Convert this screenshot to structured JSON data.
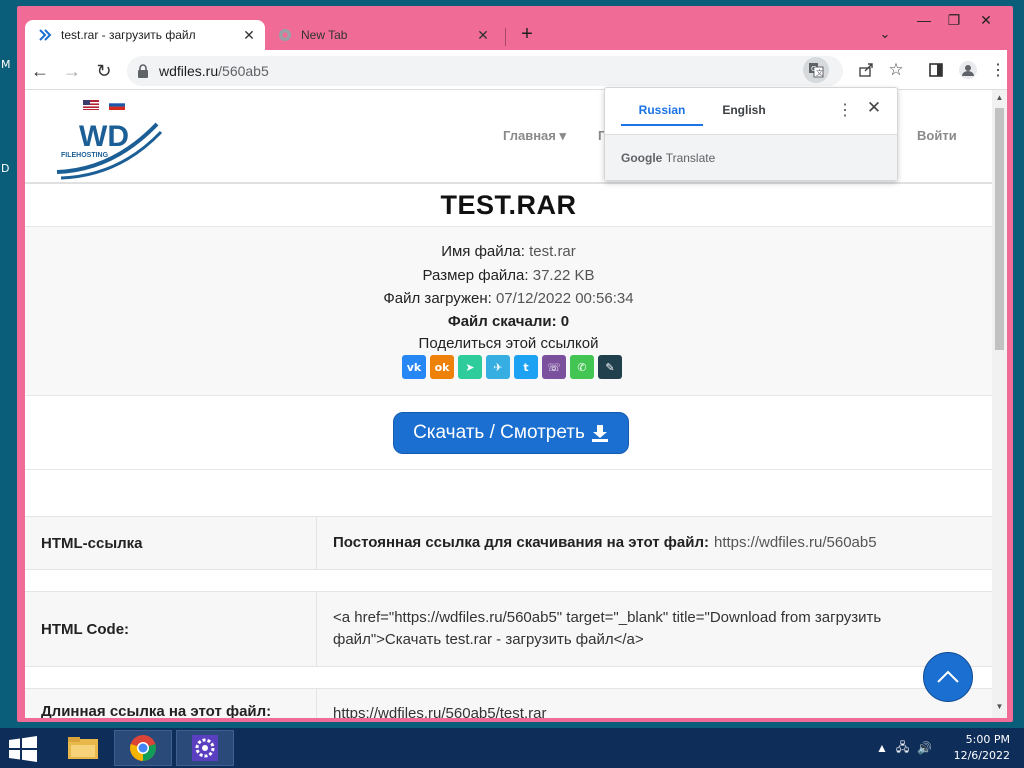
{
  "desktop": {
    "edge_letters": [
      "M",
      "D"
    ]
  },
  "browser": {
    "tabs": [
      {
        "title": "test.rar - загрузить файл",
        "icon": "wdfiles-favicon-icon",
        "active": true
      },
      {
        "title": "New Tab",
        "icon": "chrome-icon",
        "active": false
      }
    ],
    "new_tab_label": "+",
    "address": {
      "host": "wdfiles.ru",
      "path": "/560ab5"
    }
  },
  "site": {
    "languages": [
      "English",
      "Russian"
    ],
    "logo_text": "WD",
    "logo_subtext": "FILEHOSTING",
    "nav": [
      {
        "label": "Главная ▾"
      },
      {
        "label": "Пои"
      },
      {
        "label": "Войти"
      }
    ]
  },
  "file": {
    "title": "TEST.RAR",
    "name_label": "Имя файла:",
    "name_value": "test.rar",
    "size_label": "Размер файла:",
    "size_value": "37.22 KB",
    "uploaded_label": "Файл загружен:",
    "uploaded_value": "07/12/2022 00:56:34",
    "downloads_label": "Файл скачали:",
    "downloads_value": "0",
    "share_label": "Поделиться этой ссылкой",
    "share_icons": [
      {
        "name": "vk-icon",
        "glyph": "vk",
        "color": "#2787f5"
      },
      {
        "name": "odnoklassniki-icon",
        "glyph": "ok",
        "color": "#ee8208"
      },
      {
        "name": "mail-send-icon",
        "glyph": "➤",
        "color": "#2ecc9a"
      },
      {
        "name": "telegram-icon",
        "glyph": "✈",
        "color": "#37aee2"
      },
      {
        "name": "twitter-icon",
        "glyph": "t",
        "color": "#1da1f2"
      },
      {
        "name": "viber-icon",
        "glyph": "☏",
        "color": "#7b519d"
      },
      {
        "name": "whatsapp-icon",
        "glyph": "✆",
        "color": "#43c553"
      },
      {
        "name": "edit-link-icon",
        "glyph": "✎",
        "color": "#21404e"
      }
    ],
    "download_label": "Скачать / Смотреть"
  },
  "links": {
    "html_link_label": "HTML-ссылка",
    "html_link_caption": "Постоянная ссылка для скачивания на этот файл:",
    "html_link_value": "https://wdfiles.ru/560ab5",
    "html_code_label": "HTML Code:",
    "html_code_value": "<a href=\"https://wdfiles.ru/560ab5\" target=\"_blank\" title=\"Download from загрузить файл\">Скачать test.rar - загрузить файл</a>",
    "long_link_label": "Длинная ссылка на этот файл:",
    "long_link_value": "https://wdfiles.ru/560ab5/test.rar"
  },
  "translate_popup": {
    "tabs": [
      "Russian",
      "English"
    ],
    "selected": "Russian",
    "brand_google": "Google",
    "brand_translate": "Translate"
  },
  "taskbar": {
    "items": [
      "file-explorer-icon",
      "chrome-icon",
      "settings-icon"
    ],
    "time": "5:00 PM",
    "date": "12/6/2022"
  },
  "colors": {
    "window_frame": "#f06c97",
    "link_blue": "#1a6fd1",
    "translate_blue": "#1a73e8",
    "taskbar": "#0f2d59"
  }
}
